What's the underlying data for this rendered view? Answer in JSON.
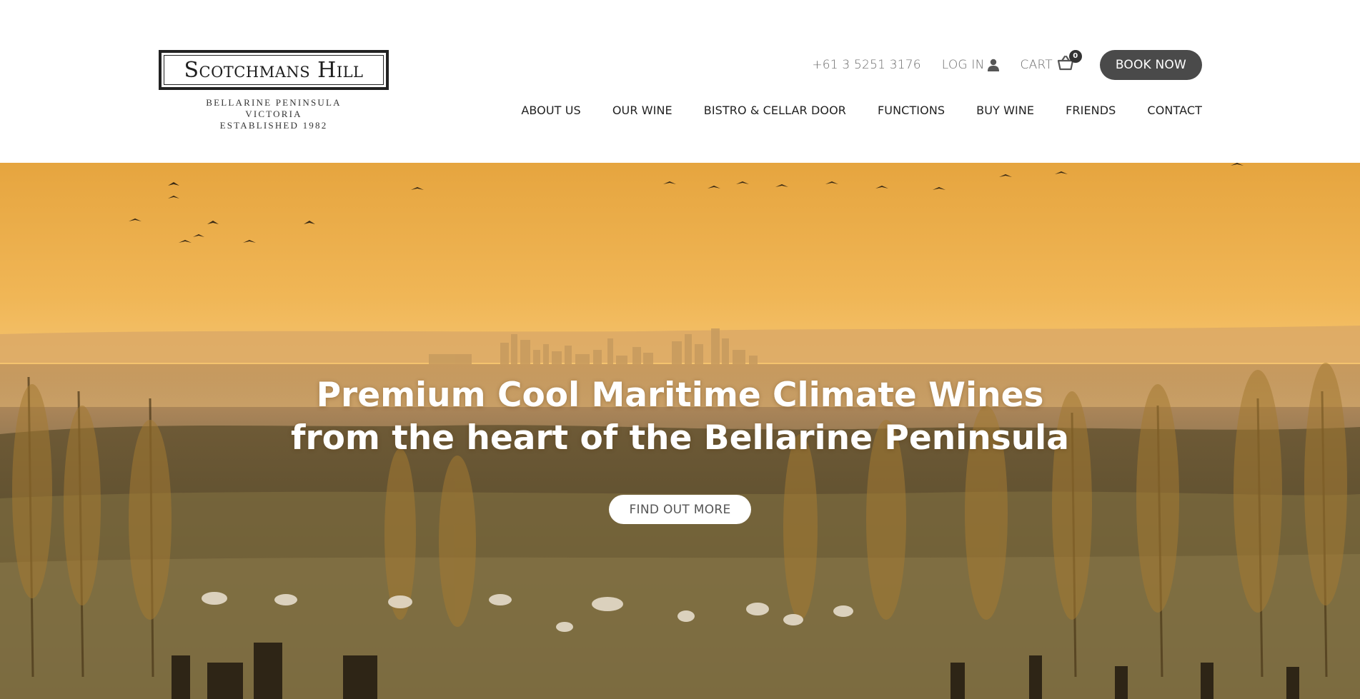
{
  "brand": {
    "name": "Scotchmans Hill",
    "tagline_lines": [
      "BELLARINE PENINSULA",
      "VICTORIA",
      "ESTABLISHED 1982"
    ]
  },
  "utility": {
    "phone": "+61 3 5251 3176",
    "login_label": "LOG IN",
    "cart_label": "CART",
    "cart_count": "0",
    "book_label": "BOOK NOW"
  },
  "nav": [
    "ABOUT US",
    "OUR WINE",
    "BISTRO & CELLAR DOOR",
    "FUNCTIONS",
    "BUY WINE",
    "FRIENDS",
    "CONTACT"
  ],
  "hero": {
    "title_line1": "Premium Cool Maritime Climate Wines",
    "title_line2": "from the heart of the Bellarine Peninsula",
    "cta_label": "FIND OUT MORE"
  },
  "colors": {
    "button_dark": "#4a4a4a",
    "sky_top": "#e8a640",
    "sky_bottom": "#f4c372",
    "text_dark": "#222222",
    "text_muted": "#6b6b6b"
  }
}
